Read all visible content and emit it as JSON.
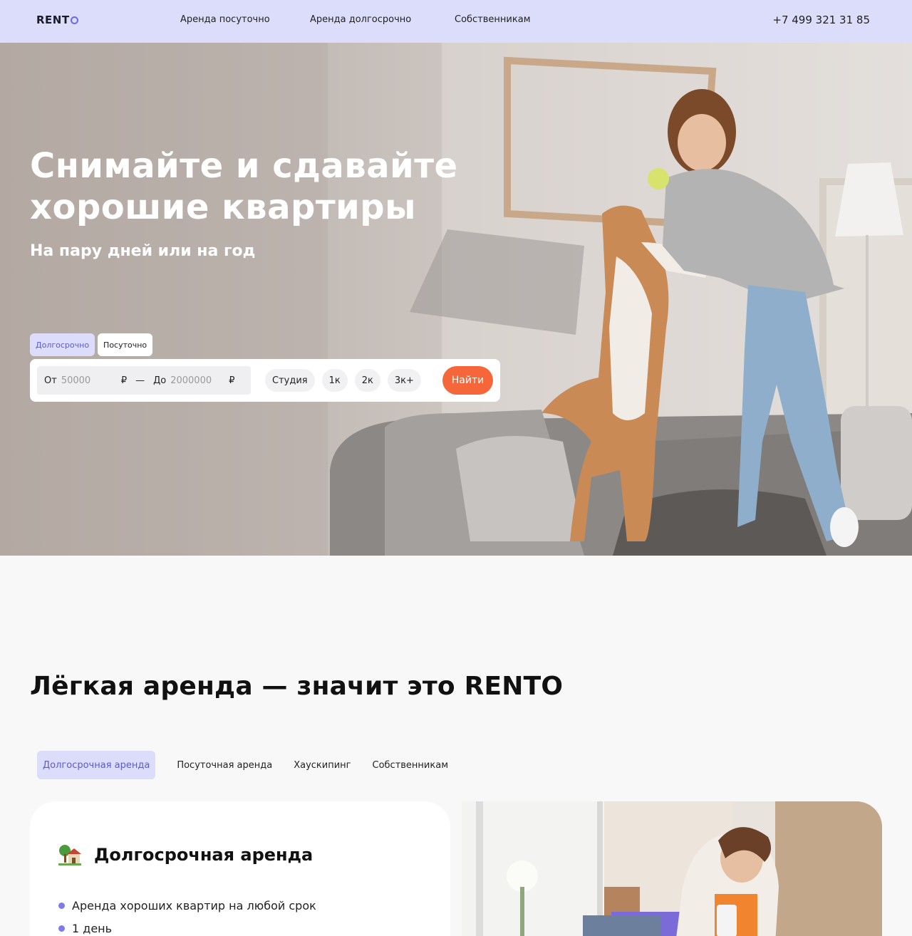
{
  "header": {
    "logo": "RENT",
    "nav": [
      "Аренда посуточно",
      "Аренда долгосрочно",
      "Собственникам"
    ],
    "phone": "+7 499 321 31 85"
  },
  "hero": {
    "title_line1": "Снимайте и сдавайте",
    "title_line2": "хорошие квартиры",
    "subtitle": "На пару дней или на год",
    "mode_tabs": [
      "Долгосрочно",
      "Посуточно"
    ],
    "search": {
      "from_label": "От",
      "from_placeholder": "50000",
      "to_label": "До",
      "to_placeholder": "2000000",
      "currency": "₽",
      "dash": "—",
      "room_chips": [
        "Студия",
        "1к",
        "2к",
        "3к+"
      ],
      "find_label": "Найти"
    }
  },
  "section": {
    "title": "Лёгкая аренда — значит это RENTO",
    "tabs": [
      "Долгосрочная аренда",
      "Посуточная аренда",
      "Хаускипинг",
      "Собственникам"
    ],
    "card": {
      "title": "Долгосрочная аренда",
      "items": [
        "Аренда хороших квартир на любой срок",
        "1 день"
      ]
    }
  },
  "colors": {
    "header_bg": "#dcdcfb",
    "accent": "#f5673a",
    "active_tab_text": "#5b5bd0",
    "bullet": "#7c7ce6"
  }
}
